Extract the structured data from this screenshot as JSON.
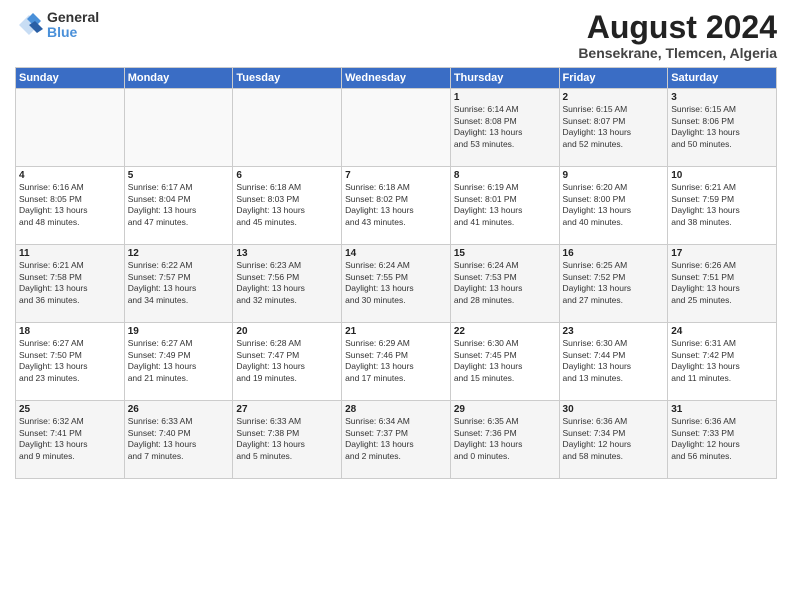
{
  "header": {
    "logo": {
      "general": "General",
      "blue": "Blue"
    },
    "title": "August 2024",
    "location": "Bensekrane, Tlemcen, Algeria"
  },
  "weekdays": [
    "Sunday",
    "Monday",
    "Tuesday",
    "Wednesday",
    "Thursday",
    "Friday",
    "Saturday"
  ],
  "weeks": [
    [
      {
        "day": "",
        "info": ""
      },
      {
        "day": "",
        "info": ""
      },
      {
        "day": "",
        "info": ""
      },
      {
        "day": "",
        "info": ""
      },
      {
        "day": "1",
        "info": "Sunrise: 6:14 AM\nSunset: 8:08 PM\nDaylight: 13 hours\nand 53 minutes."
      },
      {
        "day": "2",
        "info": "Sunrise: 6:15 AM\nSunset: 8:07 PM\nDaylight: 13 hours\nand 52 minutes."
      },
      {
        "day": "3",
        "info": "Sunrise: 6:15 AM\nSunset: 8:06 PM\nDaylight: 13 hours\nand 50 minutes."
      }
    ],
    [
      {
        "day": "4",
        "info": "Sunrise: 6:16 AM\nSunset: 8:05 PM\nDaylight: 13 hours\nand 48 minutes."
      },
      {
        "day": "5",
        "info": "Sunrise: 6:17 AM\nSunset: 8:04 PM\nDaylight: 13 hours\nand 47 minutes."
      },
      {
        "day": "6",
        "info": "Sunrise: 6:18 AM\nSunset: 8:03 PM\nDaylight: 13 hours\nand 45 minutes."
      },
      {
        "day": "7",
        "info": "Sunrise: 6:18 AM\nSunset: 8:02 PM\nDaylight: 13 hours\nand 43 minutes."
      },
      {
        "day": "8",
        "info": "Sunrise: 6:19 AM\nSunset: 8:01 PM\nDaylight: 13 hours\nand 41 minutes."
      },
      {
        "day": "9",
        "info": "Sunrise: 6:20 AM\nSunset: 8:00 PM\nDaylight: 13 hours\nand 40 minutes."
      },
      {
        "day": "10",
        "info": "Sunrise: 6:21 AM\nSunset: 7:59 PM\nDaylight: 13 hours\nand 38 minutes."
      }
    ],
    [
      {
        "day": "11",
        "info": "Sunrise: 6:21 AM\nSunset: 7:58 PM\nDaylight: 13 hours\nand 36 minutes."
      },
      {
        "day": "12",
        "info": "Sunrise: 6:22 AM\nSunset: 7:57 PM\nDaylight: 13 hours\nand 34 minutes."
      },
      {
        "day": "13",
        "info": "Sunrise: 6:23 AM\nSunset: 7:56 PM\nDaylight: 13 hours\nand 32 minutes."
      },
      {
        "day": "14",
        "info": "Sunrise: 6:24 AM\nSunset: 7:55 PM\nDaylight: 13 hours\nand 30 minutes."
      },
      {
        "day": "15",
        "info": "Sunrise: 6:24 AM\nSunset: 7:53 PM\nDaylight: 13 hours\nand 28 minutes."
      },
      {
        "day": "16",
        "info": "Sunrise: 6:25 AM\nSunset: 7:52 PM\nDaylight: 13 hours\nand 27 minutes."
      },
      {
        "day": "17",
        "info": "Sunrise: 6:26 AM\nSunset: 7:51 PM\nDaylight: 13 hours\nand 25 minutes."
      }
    ],
    [
      {
        "day": "18",
        "info": "Sunrise: 6:27 AM\nSunset: 7:50 PM\nDaylight: 13 hours\nand 23 minutes."
      },
      {
        "day": "19",
        "info": "Sunrise: 6:27 AM\nSunset: 7:49 PM\nDaylight: 13 hours\nand 21 minutes."
      },
      {
        "day": "20",
        "info": "Sunrise: 6:28 AM\nSunset: 7:47 PM\nDaylight: 13 hours\nand 19 minutes."
      },
      {
        "day": "21",
        "info": "Sunrise: 6:29 AM\nSunset: 7:46 PM\nDaylight: 13 hours\nand 17 minutes."
      },
      {
        "day": "22",
        "info": "Sunrise: 6:30 AM\nSunset: 7:45 PM\nDaylight: 13 hours\nand 15 minutes."
      },
      {
        "day": "23",
        "info": "Sunrise: 6:30 AM\nSunset: 7:44 PM\nDaylight: 13 hours\nand 13 minutes."
      },
      {
        "day": "24",
        "info": "Sunrise: 6:31 AM\nSunset: 7:42 PM\nDaylight: 13 hours\nand 11 minutes."
      }
    ],
    [
      {
        "day": "25",
        "info": "Sunrise: 6:32 AM\nSunset: 7:41 PM\nDaylight: 13 hours\nand 9 minutes."
      },
      {
        "day": "26",
        "info": "Sunrise: 6:33 AM\nSunset: 7:40 PM\nDaylight: 13 hours\nand 7 minutes."
      },
      {
        "day": "27",
        "info": "Sunrise: 6:33 AM\nSunset: 7:38 PM\nDaylight: 13 hours\nand 5 minutes."
      },
      {
        "day": "28",
        "info": "Sunrise: 6:34 AM\nSunset: 7:37 PM\nDaylight: 13 hours\nand 2 minutes."
      },
      {
        "day": "29",
        "info": "Sunrise: 6:35 AM\nSunset: 7:36 PM\nDaylight: 13 hours\nand 0 minutes."
      },
      {
        "day": "30",
        "info": "Sunrise: 6:36 AM\nSunset: 7:34 PM\nDaylight: 12 hours\nand 58 minutes."
      },
      {
        "day": "31",
        "info": "Sunrise: 6:36 AM\nSunset: 7:33 PM\nDaylight: 12 hours\nand 56 minutes."
      }
    ]
  ]
}
